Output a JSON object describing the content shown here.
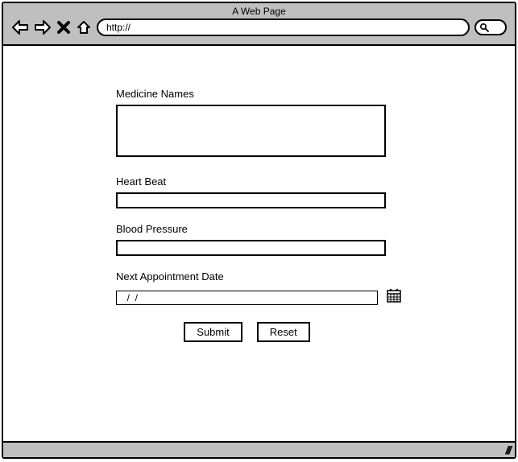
{
  "window": {
    "title": "A Web Page",
    "address": "http://"
  },
  "form": {
    "medicine_label": "Medicine Names",
    "medicine_value": "",
    "heartbeat_label": "Heart Beat",
    "heartbeat_value": "",
    "bp_label": "Blood Pressure",
    "bp_value": "",
    "appt_label": "Next Appointment Date",
    "appt_value": "  /  /",
    "submit_label": "Submit",
    "reset_label": "Reset"
  }
}
